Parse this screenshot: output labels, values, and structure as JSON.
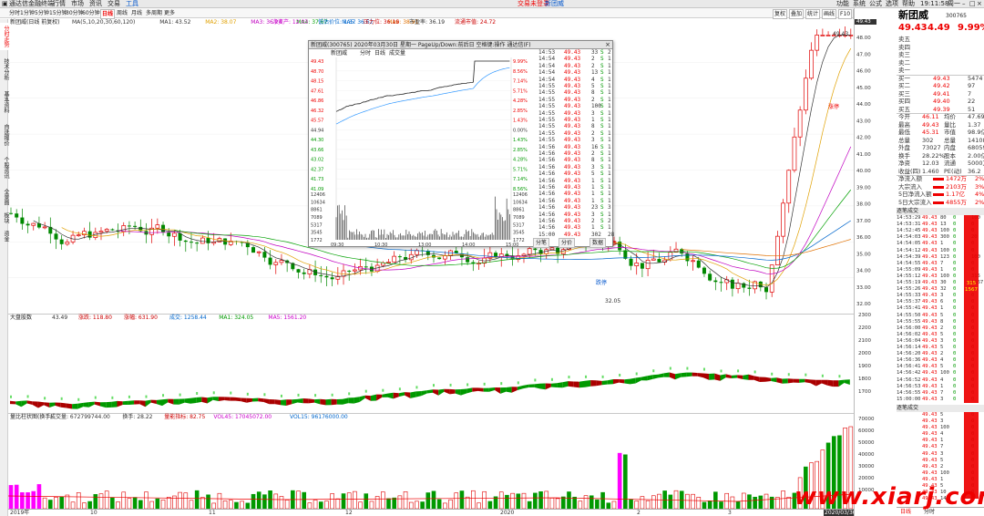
{
  "titlebar": {
    "left": "通达信金融终端",
    "menus": [
      "行情",
      "市场",
      "资讯",
      "交易",
      "工具",
      "帮助"
    ],
    "center_red": "交易未登录",
    "center_blue": "新团威",
    "right": [
      "功能",
      "系统",
      "公式",
      "选项",
      "帮助"
    ],
    "clock": "19:11:58",
    "week": "周一"
  },
  "toolbar": {
    "periods": [
      "分时",
      "1分钟",
      "5分钟",
      "15分钟",
      "30分钟",
      "60分钟",
      "日线",
      "周线",
      "月线",
      "多周期",
      "更多"
    ],
    "active_period": "日线",
    "right_buttons": [
      "复权",
      "叠加",
      "统计",
      "画线",
      "F10",
      "标记",
      "自选",
      "返回"
    ]
  },
  "sidebar": {
    "items": [
      "分时走势",
      "技术分析",
      "基本资料",
      "自选报价",
      "个股资讯",
      "全景图",
      "板块",
      "资金"
    ]
  },
  "main": {
    "header_left": "新团威(日线 前复权)",
    "ma_legend": [
      {
        "label": "MA(5,10,20,30,60,120)",
        "color": "#333333"
      },
      {
        "label": "MA1: 43.52",
        "color": "#333333"
      },
      {
        "label": "MA2: 38.07",
        "color": "#e0a000"
      },
      {
        "label": "MA3: 36.24",
        "color": "#c000c0"
      },
      {
        "label": "MA4: 37.67",
        "color": "#00a000"
      },
      {
        "label": "MA5: 36.62",
        "color": "#0066cc"
      },
      {
        "label": "MA6: 38.91",
        "color": "#e07000"
      }
    ],
    "indicator_row": [
      {
        "label": "净资产: 12.03",
        "color": "#cc00cc"
      },
      {
        "label": "低估价位: 1.37",
        "color": "#0066cc"
      },
      {
        "label": "压力位: 36.19",
        "color": "#cc0000"
      },
      {
        "label": "市盈率: 36.19",
        "color": "#333333"
      },
      {
        "label": "流通市值: 24.72",
        "color": "#cc0000"
      }
    ],
    "annotations": {
      "hi_label": "49.43",
      "lo_label": "32.05",
      "note_buy": "涨停",
      "note_sell": "跌停",
      "note_mid": "涨停"
    },
    "price_scale": [
      "49.43",
      "48.00",
      "47.00",
      "46.00",
      "45.00",
      "44.00",
      "43.00",
      "42.00",
      "41.00",
      "40.00",
      "39.00",
      "38.00",
      "37.00",
      "36.00",
      "35.00",
      "34.00",
      "33.00",
      "32.00"
    ],
    "panel2_title": "大盘股数",
    "panel2_legend": [
      {
        "label": "43.49",
        "color": "#333333"
      },
      {
        "label": "涨跌: 118.80",
        "color": "#cc0000"
      },
      {
        "label": "涨幅: 631.90",
        "color": "#cc0000"
      },
      {
        "label": "成交: 1258.44",
        "color": "#0066cc"
      },
      {
        "label": "MA1: 324.05",
        "color": "#009900"
      },
      {
        "label": "MA5: 1561.20",
        "color": "#cc00cc"
      }
    ],
    "panel2_scale": [
      "2300",
      "2200",
      "2100",
      "2000",
      "1900",
      "1800",
      "1700"
    ],
    "panel3_title": "量比柱状图(换手)",
    "panel3_legend": [
      {
        "label": "成交量: 672799744.00",
        "color": "#333333"
      },
      {
        "label": "换手: 28.22",
        "color": "#333333"
      },
      {
        "label": "量能指标: 82.75",
        "color": "#cc0000"
      },
      {
        "label": "VOL45: 17045072.00",
        "color": "#cc00cc"
      },
      {
        "label": "VOL15: 96176000.00",
        "color": "#0066cc"
      }
    ],
    "panel3_scale": [
      "70000",
      "60000",
      "50000",
      "40000",
      "30000",
      "20000",
      "10000"
    ],
    "date_axis": [
      "2019年",
      "10",
      "11",
      "12",
      "2020",
      "2",
      "3"
    ],
    "date_cursor": "2020/03/30/一"
  },
  "popup": {
    "title": "新团威(300765) 2020年03月30日 星期一 PageUp/Down:前后日 空格键:操作 通达信(F)",
    "tabs": [
      "新团威",
      "分时",
      "日线",
      "成交量"
    ],
    "left_prices": [
      "49.43",
      "48.70",
      "48.15",
      "47.61",
      "46.86",
      "46.32",
      "45.57",
      "44.94",
      "44.30",
      "43.66",
      "43.02",
      "42.37",
      "41.73",
      "41.09",
      "12406",
      "10634",
      "8861",
      "7089",
      "5317",
      "3545",
      "1772"
    ],
    "right_pcts": [
      "9.99%",
      "8.56%",
      "7.14%",
      "5.71%",
      "4.28%",
      "2.85%",
      "1.43%",
      "0.00%",
      "1.43%",
      "2.85%",
      "4.28%",
      "5.71%",
      "7.14%",
      "8.56%",
      "12406",
      "10634",
      "8861",
      "7089",
      "5317",
      "3545",
      "1772"
    ],
    "time_axis": [
      "09:30",
      "10:30",
      "13:00",
      "14:00",
      "15:00"
    ],
    "bottom_tabs": [
      "分笔",
      "分价",
      "数据"
    ],
    "ticks": [
      {
        "t": "14:53",
        "p": "49.43",
        "v": "33",
        "f": "S",
        "n": "2"
      },
      {
        "t": "14:54",
        "p": "49.43",
        "v": "2",
        "f": "S",
        "n": "1"
      },
      {
        "t": "14:54",
        "p": "49.43",
        "v": "2",
        "f": "S",
        "n": "1"
      },
      {
        "t": "14:54",
        "p": "49.43",
        "v": "13",
        "f": "S",
        "n": "1"
      },
      {
        "t": "14:54",
        "p": "49.43",
        "v": "4",
        "f": "S",
        "n": "1"
      },
      {
        "t": "14:55",
        "p": "49.43",
        "v": "5",
        "f": "S",
        "n": "1"
      },
      {
        "t": "14:55",
        "p": "49.43",
        "v": "8",
        "f": "S",
        "n": "1"
      },
      {
        "t": "14:55",
        "p": "49.43",
        "v": "2",
        "f": "S",
        "n": "1"
      },
      {
        "t": "14:55",
        "p": "49.43",
        "v": "100",
        "f": "S",
        "n": "1"
      },
      {
        "t": "14:55",
        "p": "49.43",
        "v": "3",
        "f": "S",
        "n": "1"
      },
      {
        "t": "14:55",
        "p": "49.43",
        "v": "1",
        "f": "S",
        "n": "1"
      },
      {
        "t": "14:55",
        "p": "49.43",
        "v": "8",
        "f": "S",
        "n": "1"
      },
      {
        "t": "14:55",
        "p": "49.43",
        "v": "2",
        "f": "S",
        "n": "1"
      },
      {
        "t": "14:55",
        "p": "49.43",
        "v": "3",
        "f": "S",
        "n": "1"
      },
      {
        "t": "14:56",
        "p": "49.43",
        "v": "16",
        "f": "S",
        "n": "1"
      },
      {
        "t": "14:56",
        "p": "49.43",
        "v": "2",
        "f": "S",
        "n": "1"
      },
      {
        "t": "14:56",
        "p": "49.43",
        "v": "8",
        "f": "S",
        "n": "1"
      },
      {
        "t": "14:56",
        "p": "49.43",
        "v": "3",
        "f": "S",
        "n": "1"
      },
      {
        "t": "14:56",
        "p": "49.43",
        "v": "5",
        "f": "S",
        "n": "1"
      },
      {
        "t": "14:56",
        "p": "49.43",
        "v": "1",
        "f": "S",
        "n": "1"
      },
      {
        "t": "14:56",
        "p": "49.43",
        "v": "1",
        "f": "S",
        "n": "1"
      },
      {
        "t": "14:56",
        "p": "49.43",
        "v": "1",
        "f": "S",
        "n": "1"
      },
      {
        "t": "14:56",
        "p": "49.43",
        "v": "1",
        "f": "S",
        "n": "1"
      },
      {
        "t": "14:56",
        "p": "49.43",
        "v": "23",
        "f": "S",
        "n": "3"
      },
      {
        "t": "14:56",
        "p": "49.43",
        "v": "3",
        "f": "S",
        "n": "1"
      },
      {
        "t": "14:56",
        "p": "49.43",
        "v": "2",
        "f": "S",
        "n": "2"
      },
      {
        "t": "14:56",
        "p": "49.43",
        "v": "1",
        "f": "S",
        "n": "1"
      },
      {
        "t": "15:00",
        "p": "49.43",
        "v": "302",
        "f": "",
        "n": "28"
      }
    ],
    "mini_info": [
      "2020/03/30/一",
      "46.11(2.00%)",
      "49.43",
      "45.31",
      "49.43",
      "141086",
      "6.71亿",
      "4.48(10.99%)",
      "4.12(9.37%)",
      "28.22%",
      "50007"
    ]
  },
  "quote": {
    "name": "新团威",
    "code": "300765",
    "price": "49.43",
    "change": "4.49",
    "pct": "9.99%",
    "asks": [
      {
        "l": "卖五",
        "p": "",
        "v": ""
      },
      {
        "l": "卖四",
        "p": "",
        "v": ""
      },
      {
        "l": "卖三",
        "p": "",
        "v": ""
      },
      {
        "l": "卖二",
        "p": "",
        "v": ""
      },
      {
        "l": "卖一",
        "p": "",
        "v": ""
      }
    ],
    "bids": [
      {
        "l": "买一",
        "p": "49.43",
        "v": "5474"
      },
      {
        "l": "买二",
        "p": "49.42",
        "v": "97"
      },
      {
        "l": "买三",
        "p": "49.41",
        "v": "7"
      },
      {
        "l": "买四",
        "p": "49.40",
        "v": "22"
      },
      {
        "l": "买五",
        "p": "49.39",
        "v": "51"
      }
    ],
    "stats": [
      {
        "a": "今开",
        "b": "46.11",
        "c": "均价",
        "d": "47.69"
      },
      {
        "a": "最高",
        "b": "49.43",
        "c": "量比",
        "d": "1.37"
      },
      {
        "a": "最低",
        "b": "45.31",
        "c": "市值",
        "d": "98.9亿"
      },
      {
        "a": "总量",
        "b": "302",
        "c": "总量",
        "d": "141086"
      },
      {
        "a": "外盘",
        "b": "73027",
        "c": "内盘",
        "d": "68059"
      },
      {
        "a": "换手",
        "b": "28.22%",
        "c": "股本",
        "d": "2.00亿"
      },
      {
        "a": "净资",
        "b": "12.03",
        "c": "流通",
        "d": "5000万"
      },
      {
        "a": "收益(四)",
        "b": "1.460",
        "c": "PE(动)",
        "d": "36.2"
      }
    ],
    "flows": [
      {
        "l": "净流入额",
        "v": "1472万",
        "p": "2%"
      },
      {
        "l": "大宗流入",
        "v": "2103万",
        "p": "3%"
      },
      {
        "l": "5日净流入额",
        "v": "1.17亿",
        "p": "4%"
      },
      {
        "l": "5日大宗流入",
        "v": "4855万",
        "p": "2%"
      }
    ],
    "fs1_title": "逐笔成交",
    "fs2_title": "逐笔成交",
    "fs1": [
      [
        "14:53:29",
        "49.43",
        "80",
        "0",
        "100"
      ],
      [
        "14:53:31",
        "49.43",
        "13",
        "0",
        "0"
      ],
      [
        "14:52:45",
        "49.43",
        "100",
        "0",
        "0"
      ],
      [
        "14:54:03",
        "49.43",
        "300",
        "0",
        "20"
      ],
      [
        "14:54:05",
        "49.43",
        "1",
        "0",
        "0"
      ],
      [
        "14:54:12",
        "49.43",
        "100",
        "0",
        "0"
      ],
      [
        "14:54:39",
        "49.43",
        "123",
        "0",
        "100"
      ],
      [
        "14:54:55",
        "49.43",
        "7",
        "0",
        "0"
      ],
      [
        "14:55:09",
        "49.43",
        "1",
        "0",
        "0"
      ],
      [
        "14:55:12",
        "49.43",
        "100",
        "0",
        "315"
      ],
      [
        "14:55:19",
        "49.43",
        "30",
        "0",
        "1567"
      ],
      [
        "14:55:26",
        "49.43",
        "32",
        "0",
        "0"
      ],
      [
        "14:55:33",
        "49.43",
        "3",
        "0",
        "0"
      ],
      [
        "14:55:37",
        "49.43",
        "6",
        "0",
        "0"
      ],
      [
        "14:55:41",
        "49.43",
        "1",
        "0",
        "0"
      ],
      [
        "14:55:50",
        "49.43",
        "5",
        "0",
        "0"
      ],
      [
        "14:55:55",
        "49.43",
        "8",
        "0",
        "0"
      ],
      [
        "14:56:00",
        "49.43",
        "2",
        "0",
        "0"
      ],
      [
        "14:56:02",
        "49.43",
        "5",
        "0",
        "0"
      ],
      [
        "14:56:04",
        "49.43",
        "3",
        "0",
        "0"
      ],
      [
        "14:56:14",
        "49.43",
        "5",
        "0",
        "0"
      ],
      [
        "14:56:20",
        "49.43",
        "2",
        "0",
        "0"
      ],
      [
        "14:56:36",
        "49.43",
        "4",
        "0",
        "0"
      ],
      [
        "14:56:41",
        "49.43",
        "5",
        "0",
        "0"
      ],
      [
        "14:56:42",
        "49.43",
        "100",
        "0",
        "0"
      ],
      [
        "14:56:52",
        "49.43",
        "4",
        "0",
        "0"
      ],
      [
        "14:56:53",
        "49.43",
        "1",
        "0",
        "0"
      ],
      [
        "14:56:55",
        "49.43",
        "7",
        "0",
        "0"
      ],
      [
        "15:00:00",
        "49.43",
        "3",
        "0",
        "0"
      ]
    ],
    "fs2": [
      [
        "49.43",
        "5",
        "0"
      ],
      [
        "49.43",
        "3",
        "0"
      ],
      [
        "49.43",
        "100",
        "0"
      ],
      [
        "49.43",
        "4",
        "0"
      ],
      [
        "49.43",
        "1",
        "0"
      ],
      [
        "49.43",
        "7",
        "0"
      ],
      [
        "49.43",
        "3",
        "0"
      ],
      [
        "49.43",
        "5",
        "0"
      ],
      [
        "49.43",
        "2",
        "0"
      ],
      [
        "49.43",
        "100",
        "0"
      ],
      [
        "49.43",
        "1",
        "0"
      ],
      [
        "49.43",
        "5",
        "0"
      ],
      [
        "49.43",
        "10",
        "0"
      ],
      [
        "49.43",
        "14",
        "0"
      ],
      [
        "49.43",
        "9",
        "0"
      ],
      [
        "49.43",
        "7",
        "0"
      ],
      [
        "49.43",
        "3",
        "0"
      ],
      [
        "49.43",
        "8",
        "0"
      ],
      [
        "49.43",
        "7",
        "0"
      ],
      [
        "49.43",
        "1",
        "0"
      ]
    ],
    "fs2_side": [
      "315",
      "1567"
    ],
    "bottom_tabs": [
      "日线",
      "分时"
    ]
  },
  "watermark": "www.xiarj.com",
  "colors": {
    "up": "#e00000",
    "down": "#008800",
    "bg": "#ffffff",
    "grid": "#dcdcdc"
  }
}
